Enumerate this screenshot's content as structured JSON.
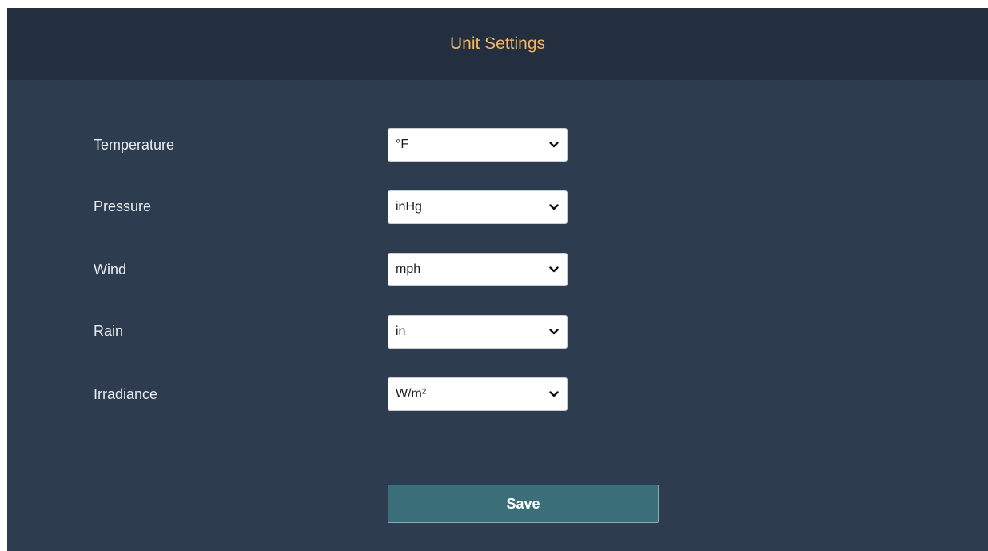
{
  "header": {
    "title": "Unit Settings"
  },
  "settings": [
    {
      "label": "Temperature",
      "value": "°F"
    },
    {
      "label": "Pressure",
      "value": "inHg"
    },
    {
      "label": "Wind",
      "value": "mph"
    },
    {
      "label": "Rain",
      "value": "in"
    },
    {
      "label": "Irradiance",
      "value": "W/m²"
    }
  ],
  "save_button": {
    "label": "Save"
  },
  "colors": {
    "header_background": "#232f3f",
    "panel_background": "#2e3c4f",
    "title_accent": "#f5b563",
    "save_button_background": "#3a6e78"
  },
  "icons": {
    "select_arrow": "chevron-down-icon"
  }
}
